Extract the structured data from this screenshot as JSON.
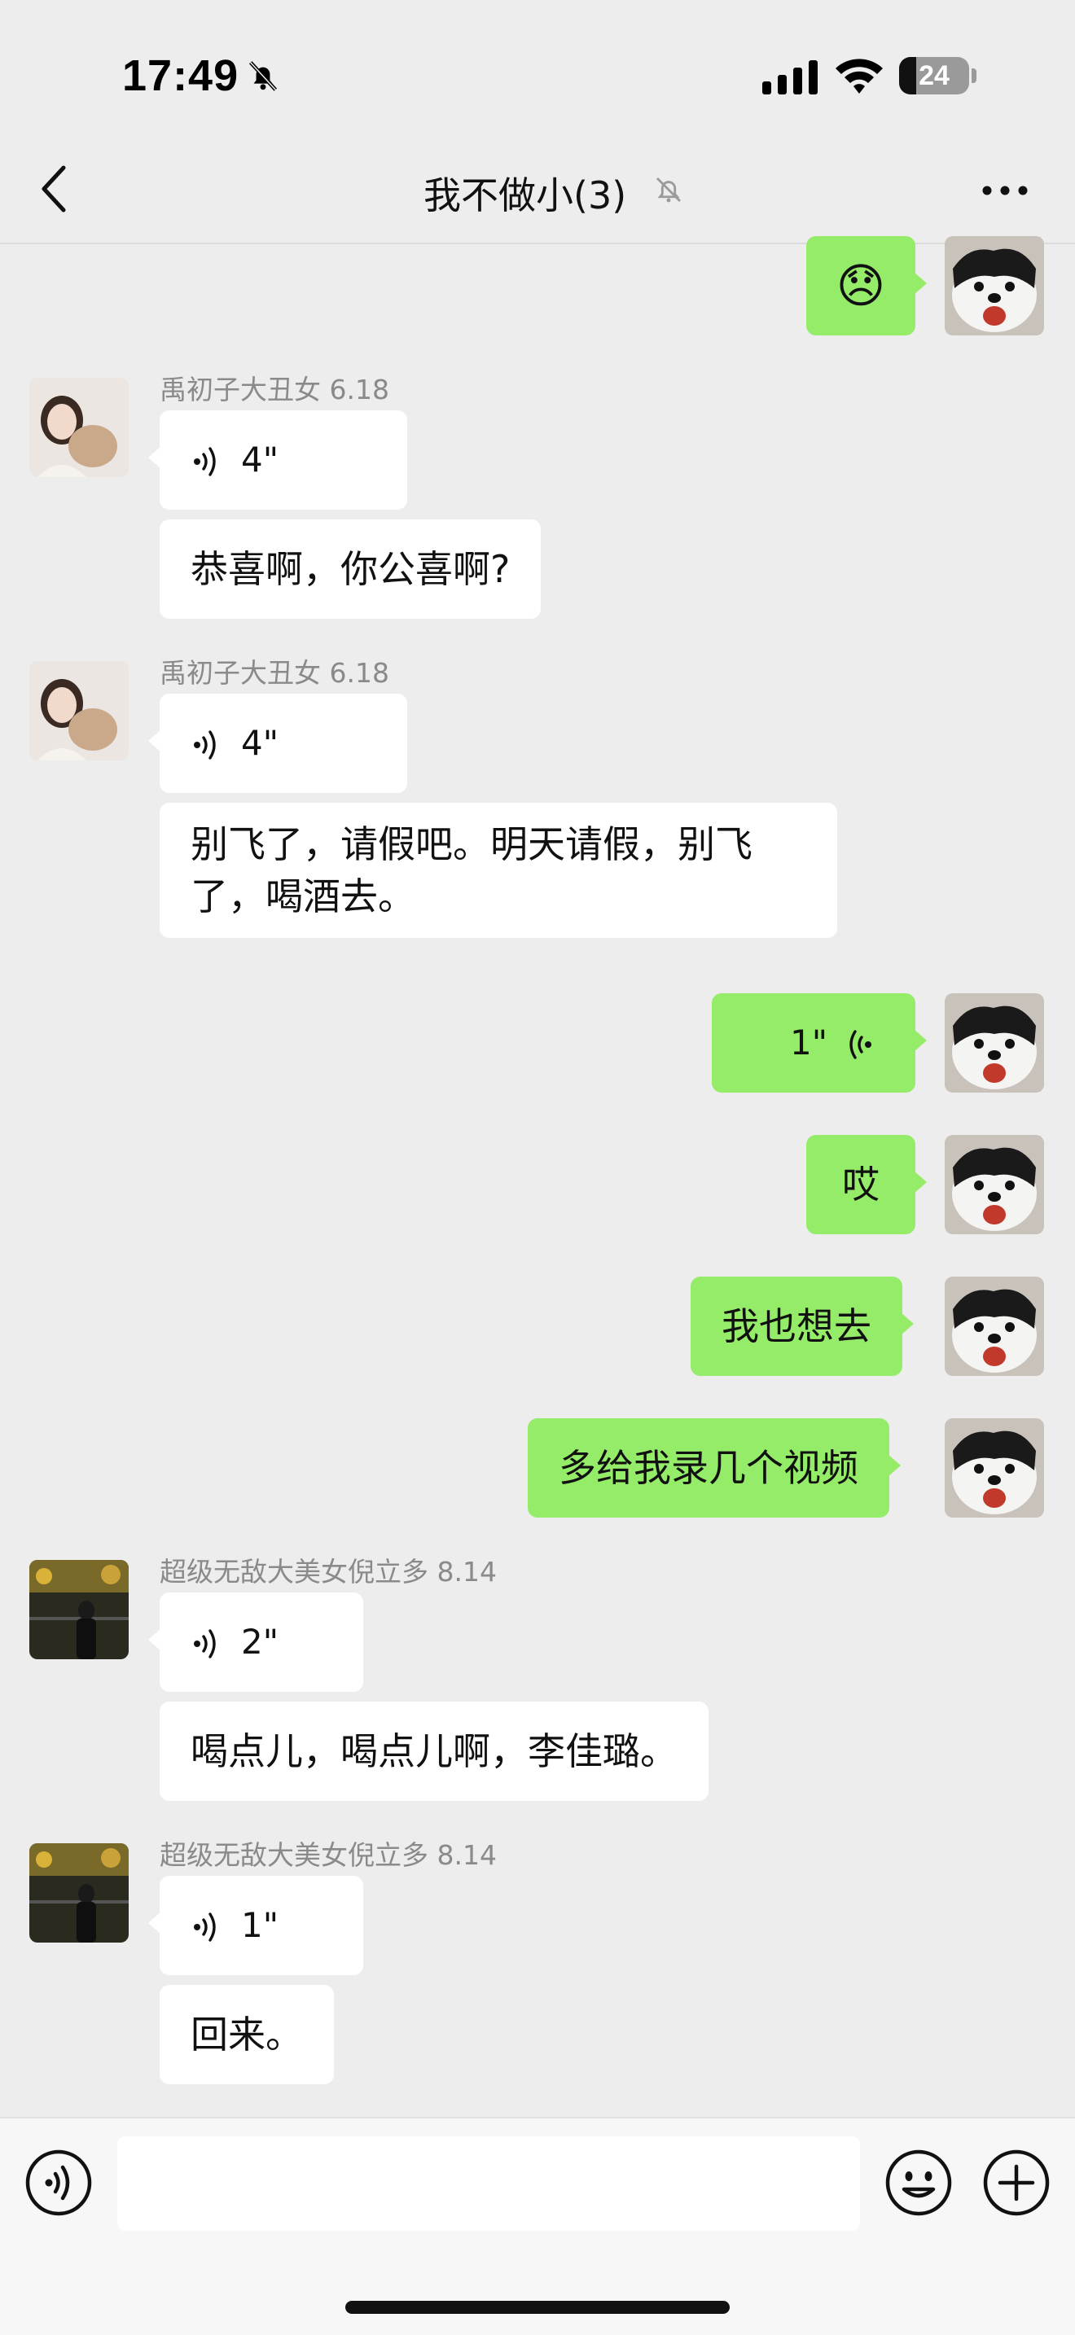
{
  "status_bar": {
    "time": "17:49",
    "battery_level": "24",
    "battery_fraction": 0.24,
    "icons": [
      "bell-off-icon",
      "signal-icon",
      "wifi-icon",
      "battery-icon"
    ]
  },
  "nav": {
    "title": "我不做小(3)",
    "icons": [
      "chevron-left-icon",
      "bell-off-icon",
      "more-icon"
    ]
  },
  "messages": [
    {
      "dir": "out",
      "type": "emoji",
      "emoji": "😞"
    },
    {
      "dir": "in",
      "sender": "禹初子大丑女 6.18",
      "items": [
        {
          "type": "voice",
          "duration": "4\""
        },
        {
          "type": "text",
          "text": "恭喜啊，你公喜啊?"
        }
      ]
    },
    {
      "dir": "in",
      "sender": "禹初子大丑女 6.18",
      "items": [
        {
          "type": "voice",
          "duration": "4\""
        },
        {
          "type": "text",
          "text": "别飞了，请假吧。明天请假，别飞了，喝酒去。"
        }
      ]
    },
    {
      "dir": "out",
      "type": "voice",
      "duration": "1\""
    },
    {
      "dir": "out",
      "type": "text",
      "text": "哎"
    },
    {
      "dir": "out",
      "type": "text",
      "text": "我也想去"
    },
    {
      "dir": "out",
      "type": "text",
      "text": "多给我录几个视频"
    },
    {
      "dir": "in",
      "sender": "超级无敌大美女倪立多 8.14",
      "items": [
        {
          "type": "voice",
          "duration": "2\""
        },
        {
          "type": "text",
          "text": "喝点儿，喝点儿啊，李佳璐。"
        }
      ]
    },
    {
      "dir": "in",
      "sender": "超级无敌大美女倪立多 8.14",
      "items": [
        {
          "type": "voice",
          "duration": "1\""
        },
        {
          "type": "text",
          "text": "回来。"
        }
      ]
    }
  ],
  "input_bar": {
    "message_value": "",
    "icons": [
      "voice-input-icon",
      "emoji-icon",
      "plus-icon"
    ]
  },
  "colors": {
    "background": "#ededed",
    "bubble_out": "#95ec69",
    "bubble_in": "#ffffff",
    "sender_name": "#8a8a8a"
  }
}
